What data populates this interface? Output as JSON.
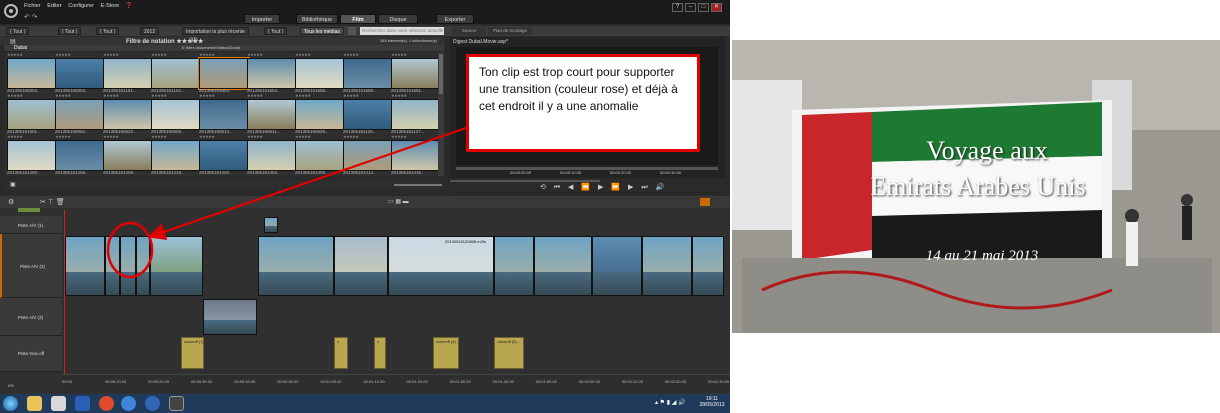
{
  "app": {
    "menu": [
      "Fichier",
      "Editer",
      "Configurer",
      "E-Store"
    ],
    "help_icon": "question-icon",
    "mode_tabs": [
      "Importer",
      "Bibliothèque",
      "Film",
      "Disque",
      "Exporter"
    ],
    "active_mode": "Film",
    "win_buttons": [
      "?",
      "–",
      "□",
      "✕"
    ]
  },
  "library": {
    "breadcrumbs": [
      "( Tout )",
      "( Tout )",
      "( Tout )",
      "2012",
      "Importation la plus récente",
      "( Tout )",
      "Tous les médias"
    ],
    "search_placeholder": "Rechercher dans votre sélection actuelle",
    "collection_title": "Filtre de notation ★★★★★",
    "mode_3d": "3D",
    "folder_name": "Dubai",
    "folder_path": "E:\\Mes documents\\Vidéos\\Dubai",
    "element_count": "345 élément(s), 1 sélectionné(s)",
    "thumbs_row1": [
      "201305150003...",
      "201305150003...",
      "201305151101...",
      "201305151103...",
      "201305151553...",
      "201305151554...",
      "201305151555...",
      "201305151559...",
      "201305151591..."
    ],
    "thumbs_row2": [
      "201305151601...",
      "201305160052...",
      "201305160522...",
      "201305160505...",
      "201305160514...",
      "201305160511...",
      "201305160526...",
      "201305161125...",
      "201305161127..."
    ],
    "thumbs_row3": [
      "201305161200...",
      "201305161206...",
      "201305161209...",
      "201305161218...",
      "201305161220...",
      "201305161403...",
      "201305161405...",
      "201305161414...",
      "201305161415..."
    ]
  },
  "preview": {
    "project_tab": "Digest Dubaï.Movie.axp*",
    "tabs": [
      "Source",
      "Plan de montage"
    ],
    "timecodes": [
      "00:00:00.00",
      "00:00:10.00",
      "00:00:20.00",
      "00:00:30.00"
    ],
    "transport_icons": [
      "loop-icon",
      "go-start-icon",
      "prev-frame-icon",
      "rewind-icon",
      "play-icon",
      "forward-icon",
      "next-frame-icon",
      "go-end-icon",
      "volume-icon"
    ]
  },
  "timeline": {
    "tracks": [
      {
        "label": "Piste A/V (1)"
      },
      {
        "label": "Piste A/V (2)"
      },
      {
        "label": "Piste A/V (3)"
      },
      {
        "label": "Piste Voix-off"
      }
    ],
    "clip_title": "20130516120805.m2ts",
    "voiceover_clips": [
      "voiceoff (1)...",
      "v",
      "v",
      "voiceoff (4)...",
      "voiceoff (5)..."
    ],
    "ruler": [
      "00:00",
      "00:00:10.00",
      "00:00:20.00",
      "00:00:30.00",
      "00:00:40.00",
      "00:00:50.00",
      "00:01:00.00",
      "00:01:10.00",
      "00:01:20.00",
      "00:01:30.00",
      "00:01:40.00",
      "00:01:50.00",
      "00:02:00.00",
      "00:02:10.00",
      "00:02:20.00",
      "00:02:30.00"
    ],
    "zoom": "0%"
  },
  "taskbar": {
    "time": "19:11",
    "date": "28/05/2013"
  },
  "annotation": {
    "text": "Ton clip est trop court pour supporter une transition (couleur rose) et déjà à cet endroit il y a une anomalie",
    "border_color": "#e00000",
    "arrow_color": "#e00000"
  },
  "photo_title": {
    "line1": "Voyage aux",
    "line2": "Emirats Arabes Unis",
    "line3": "14 au 21 mai 2013"
  }
}
